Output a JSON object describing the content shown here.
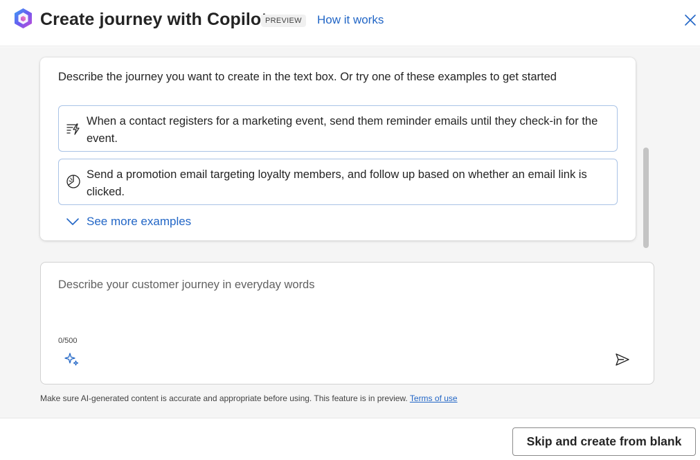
{
  "header": {
    "title": "Create journey with Copilot",
    "badge": "PREVIEW",
    "how_link": "How it works",
    "logo_icon": "copilot-logo",
    "close_icon": "close-icon"
  },
  "examples": {
    "intro": "Describe the journey you want to create in the text box. Or try one of these examples to get started",
    "items": [
      {
        "icon": "lightning-text-icon",
        "text": "When a contact registers for a marketing event, send them reminder emails until they check-in for the event."
      },
      {
        "icon": "pie-chart-icon",
        "text": "Send a promotion email targeting loyalty members, and follow up based on whether an email link is clicked."
      }
    ],
    "see_more": "See more examples"
  },
  "input": {
    "value": "",
    "placeholder": "Describe your customer journey in everyday words",
    "counter": "0/500"
  },
  "disclaimer": {
    "text": "Make sure AI-generated content is accurate and appropriate before using. This feature is in preview.",
    "terms_link": "Terms of use"
  },
  "footer": {
    "skip_button": "Skip and create from blank"
  },
  "colors": {
    "accent": "#2266c6",
    "example_border": "#a9c3e6",
    "body_background": "#f5f5f5"
  }
}
